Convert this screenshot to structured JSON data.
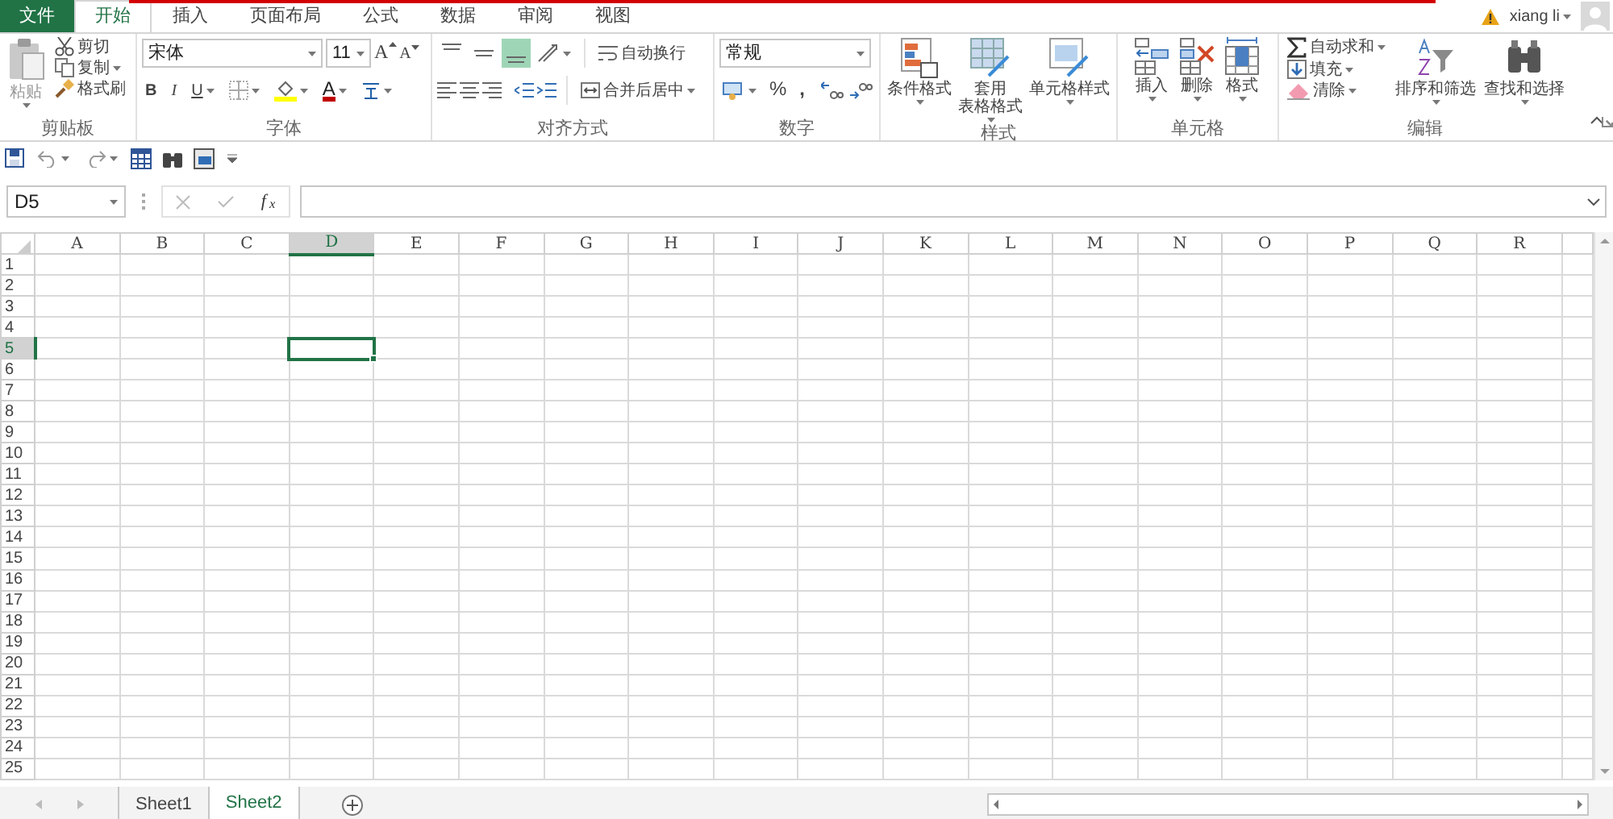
{
  "tabs": [
    {
      "label": "文件",
      "kind": "file",
      "selected": false
    },
    {
      "label": "开始",
      "kind": "tab",
      "selected": true
    },
    {
      "label": "插入",
      "kind": "tab",
      "selected": false
    },
    {
      "label": "页面布局",
      "kind": "tab",
      "selected": false
    },
    {
      "label": "公式",
      "kind": "tab",
      "selected": false
    },
    {
      "label": "数据",
      "kind": "tab",
      "selected": false
    },
    {
      "label": "审阅",
      "kind": "tab",
      "selected": false
    },
    {
      "label": "视图",
      "kind": "tab",
      "selected": false
    }
  ],
  "account": {
    "user": "xiang li"
  },
  "ribbon": {
    "clipboard": {
      "label": "剪贴板",
      "paste": "粘贴",
      "cut": "剪切",
      "copy": "复制",
      "painter": "格式刷"
    },
    "font": {
      "label": "字体",
      "font_name": "宋体",
      "font_size": "11",
      "grow_font": "A",
      "shrink_font": "A",
      "bold": "B",
      "italic": "I",
      "underline": "U",
      "font_color": "A"
    },
    "alignment": {
      "label": "对齐方式",
      "wrap": "自动换行",
      "merge": "合并后居中",
      "vertical_align": [
        {
          "selected": false
        },
        {
          "selected": false
        },
        {
          "selected": true
        }
      ]
    },
    "number": {
      "label": "数字",
      "format": "常规",
      "percent": "%",
      "comma": ","
    },
    "styles": {
      "label": "样式",
      "conditional": "条件格式",
      "table": "套用",
      "table_2": "表格格式",
      "cell_styles": "单元格样式"
    },
    "cells": {
      "label": "单元格",
      "insert": "插入",
      "delete": "删除",
      "format": "格式"
    },
    "editing": {
      "label": "编辑",
      "autosum": "自动求和",
      "fill": "填充",
      "clear": "清除",
      "sort": "排序和筛选",
      "find": "查找和选择"
    }
  },
  "formula_bar": {
    "name_box": "D5",
    "fx": "f$_{x}$"
  },
  "grid": {
    "columns": [
      {
        "label": "A",
        "selected": false
      },
      {
        "label": "B",
        "selected": false
      },
      {
        "label": "C",
        "selected": false
      },
      {
        "label": "D",
        "selected": true
      },
      {
        "label": "E",
        "selected": false
      },
      {
        "label": "F",
        "selected": false
      },
      {
        "label": "G",
        "selected": false
      },
      {
        "label": "H",
        "selected": false
      },
      {
        "label": "I",
        "selected": false
      },
      {
        "label": "J",
        "selected": false
      },
      {
        "label": "K",
        "selected": false
      },
      {
        "label": "L",
        "selected": false
      },
      {
        "label": "M",
        "selected": false
      },
      {
        "label": "N",
        "selected": false
      },
      {
        "label": "O",
        "selected": false
      },
      {
        "label": "P",
        "selected": false
      },
      {
        "label": "Q",
        "selected": false
      },
      {
        "label": "R",
        "selected": false
      }
    ],
    "rows": [
      {
        "label": "1",
        "selected": false
      },
      {
        "label": "2",
        "selected": false
      },
      {
        "label": "3",
        "selected": false
      },
      {
        "label": "4",
        "selected": false
      },
      {
        "label": "5",
        "selected": true
      },
      {
        "label": "6",
        "selected": false
      },
      {
        "label": "7",
        "selected": false
      },
      {
        "label": "8",
        "selected": false
      },
      {
        "label": "9",
        "selected": false
      },
      {
        "label": "10",
        "selected": false
      },
      {
        "label": "11",
        "selected": false
      },
      {
        "label": "12",
        "selected": false
      },
      {
        "label": "13",
        "selected": false
      },
      {
        "label": "14",
        "selected": false
      },
      {
        "label": "15",
        "selected": false
      },
      {
        "label": "16",
        "selected": false
      },
      {
        "label": "17",
        "selected": false
      },
      {
        "label": "18",
        "selected": false
      },
      {
        "label": "19",
        "selected": false
      },
      {
        "label": "20",
        "selected": false
      },
      {
        "label": "21",
        "selected": false
      },
      {
        "label": "22",
        "selected": false
      },
      {
        "label": "23",
        "selected": false
      },
      {
        "label": "24",
        "selected": false
      },
      {
        "label": "25",
        "selected": false
      }
    ]
  },
  "sheets": [
    {
      "name": "Sheet1",
      "selected": false
    },
    {
      "name": "Sheet2",
      "selected": true
    }
  ]
}
